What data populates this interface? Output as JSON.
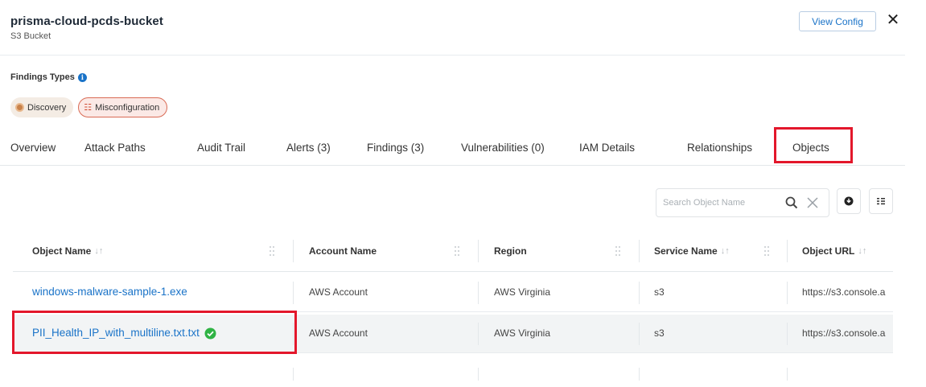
{
  "header": {
    "title": "prisma-cloud-pcds-bucket",
    "subtitle": "S3 Bucket",
    "view_config_label": "View Config"
  },
  "findings": {
    "label": "Findings Types",
    "chips": [
      {
        "label": "Discovery",
        "icon": "discovery-icon"
      },
      {
        "label": "Misconfiguration",
        "icon": "misconfiguration-icon"
      }
    ]
  },
  "tabs": [
    {
      "label": "Overview"
    },
    {
      "label": "Attack Paths"
    },
    {
      "label": "Audit Trail"
    },
    {
      "label": "Alerts (3)"
    },
    {
      "label": "Findings (3)"
    },
    {
      "label": "Vulnerabilities (0)"
    },
    {
      "label": "IAM Details"
    },
    {
      "label": "Relationships"
    },
    {
      "label": "Objects",
      "active": true
    }
  ],
  "search": {
    "placeholder": "Search Object Name"
  },
  "table": {
    "columns": [
      {
        "label": "Object Name",
        "sortable": true
      },
      {
        "label": "Account Name",
        "sortable": false
      },
      {
        "label": "Region",
        "sortable": false
      },
      {
        "label": "Service Name",
        "sortable": true
      },
      {
        "label": "Object URL",
        "sortable": true
      }
    ],
    "rows": [
      {
        "object_name": "windows-malware-sample-1.exe",
        "account_name": "AWS Account",
        "region": "AWS Virginia",
        "service_name": "s3",
        "object_url": "https://s3.console.a"
      },
      {
        "object_name": "PII_Health_IP_with_multiline.txt.txt",
        "account_name": "AWS Account",
        "region": "AWS Virginia",
        "service_name": "s3",
        "object_url": "https://s3.console.a",
        "verified": true
      }
    ]
  },
  "colors": {
    "link": "#1a73c8",
    "highlight": "#e3172b",
    "success": "#2fb344"
  }
}
